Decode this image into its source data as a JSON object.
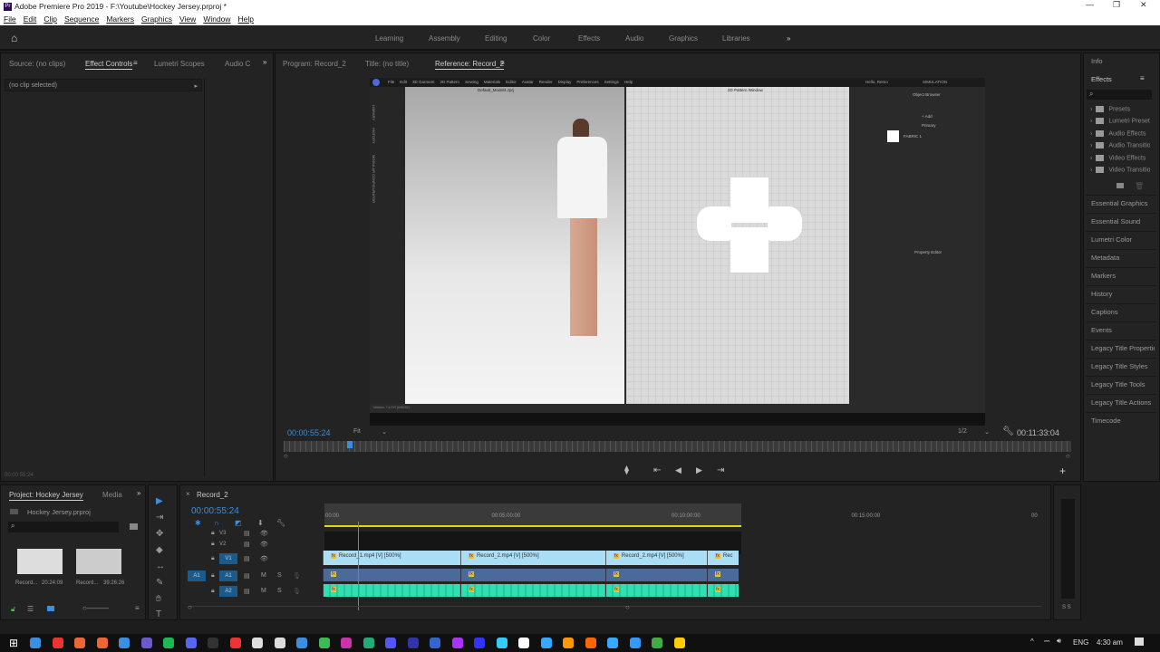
{
  "window": {
    "title": "Adobe Premiere Pro 2019 - F:\\Youtube\\Hockey Jersey.prproj *",
    "app_icon": "Pr"
  },
  "menu": [
    "File",
    "Edit",
    "Clip",
    "Sequence",
    "Markers",
    "Graphics",
    "View",
    "Window",
    "Help"
  ],
  "workspaces": [
    "Learning",
    "Assembly",
    "Editing",
    "Color",
    "Effects",
    "Audio",
    "Graphics",
    "Libraries"
  ],
  "left_panel": {
    "tabs": [
      "Source: (no clips)",
      "Effect Controls",
      "Lumetri Scopes",
      "Audio C"
    ],
    "active_tab": "Effect Controls",
    "clip_selector": "(no clip selected)",
    "timecode": "00:00:55:24"
  },
  "monitor": {
    "tabs": [
      "Program: Record_2",
      "Title: (no title)",
      "Reference: Record_2"
    ],
    "active_tab": "Reference: Record_2",
    "current_time": "00:00:55:24",
    "zoom": "Fit",
    "resolution": "1/2",
    "duration": "00:11:33:04",
    "playhead_fraction": 0.08
  },
  "embedded_app": {
    "menu": [
      "File",
      "Edit",
      "3D Garment",
      "2D Pattern",
      "Sewing",
      "Materials",
      "Editor",
      "Avatar",
      "Render",
      "Display",
      "Preferences",
      "Settings",
      "Help"
    ],
    "left_window_title": "Default_Model4.zprj",
    "right_window_title": "2D Pattern Window",
    "greeting": "Hello, Remo",
    "mode": "SIMULATION",
    "object_browser": "Object Browser",
    "add_label": "+ Add",
    "group": "Primary",
    "fabric": "FABRIC 1",
    "property_editor": "Property Editor",
    "side_tabs": [
      "LIBRARY",
      "HISTORY",
      "MODULAR CONFIGURATOR"
    ],
    "version": "Version: 7.4.0 R (#45202)"
  },
  "right_panel": {
    "info": "Info",
    "effects_title": "Effects",
    "effects_tree": [
      "Presets",
      "Lumetri Presets",
      "Audio Effects",
      "Audio Transitions",
      "Video Effects",
      "Video Transitions"
    ],
    "panels": [
      "Essential Graphics",
      "Essential Sound",
      "Lumetri Color",
      "Metadata",
      "Markers",
      "History",
      "Captions",
      "Events",
      "Legacy Title Properties",
      "Legacy Title Styles",
      "Legacy Title Tools",
      "Legacy Title Actions",
      "Timecode"
    ]
  },
  "project": {
    "tabs": [
      "Project: Hockey Jersey",
      "Media"
    ],
    "file": "Hockey Jersey.prproj",
    "items": [
      {
        "name": "Record...",
        "duration": "20:24:09"
      },
      {
        "name": "Record...",
        "duration": "39:26:26"
      }
    ]
  },
  "timeline": {
    "sequence": "Record_2",
    "timecode": "00:00:55:24",
    "ruler": [
      "00:00",
      "00:05:00:00",
      "00:10:00:00",
      "00:15:00:00",
      "00"
    ],
    "playhead_minutes": 0.93,
    "tracks": [
      "V3",
      "V2",
      "V1",
      "A1",
      "A2"
    ],
    "clips": [
      {
        "label": "Record_1.mp4 [V] [500%]",
        "start_min": 0,
        "end_min": 3.83
      },
      {
        "label": "Record_2.mp4 [V] [500%]",
        "start_min": 3.83,
        "end_min": 7.86
      },
      {
        "label": "Record_2.mp4 [V] [500%]",
        "start_min": 7.86,
        "end_min": 10.68
      },
      {
        "label": "Rec",
        "start_min": 10.68,
        "end_min": 11.55
      }
    ],
    "mute": "M",
    "solo": "S"
  },
  "taskbar": {
    "language": "ENG",
    "time": "4:30 am"
  },
  "colors": {
    "accent": "#3a8fe0",
    "video_clip": "#a9def5",
    "audio_clip": "#2fe0b0",
    "work_area": "#e6d800"
  }
}
